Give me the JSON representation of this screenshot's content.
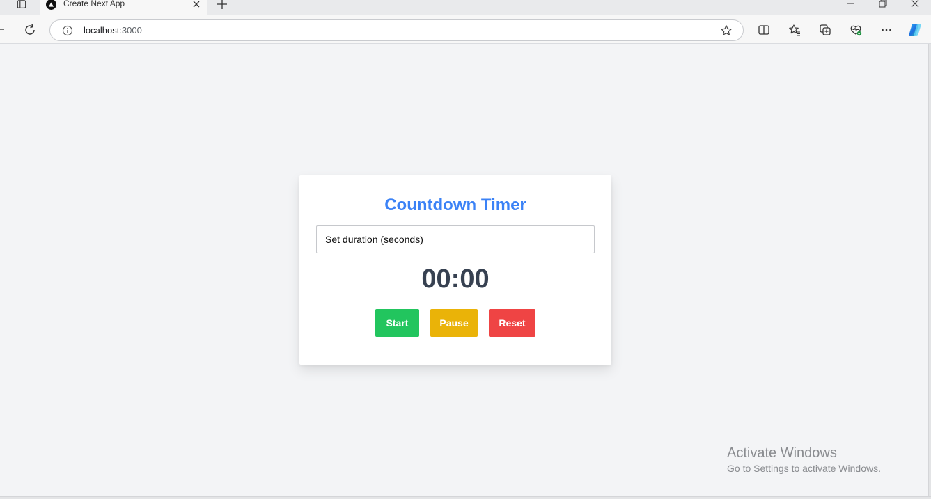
{
  "browser": {
    "tab": {
      "title": "Create Next App"
    },
    "address_bar": {
      "host": "localhost",
      "port": ":3000"
    }
  },
  "app": {
    "title": "Countdown Timer",
    "duration_input": {
      "placeholder": "Set duration (seconds)",
      "value": ""
    },
    "time_display": "00:00",
    "buttons": {
      "start": {
        "label": "Start",
        "color": "#22c55e"
      },
      "pause": {
        "label": "Pause",
        "color": "#eab308"
      },
      "reset": {
        "label": "Reset",
        "color": "#ef4444"
      }
    }
  },
  "watermark": {
    "title": "Activate Windows",
    "subtitle": "Go to Settings to activate Windows."
  },
  "colors": {
    "accent": "#3b82f6",
    "page_background": "#f3f4f6",
    "timer_text": "#374151"
  }
}
